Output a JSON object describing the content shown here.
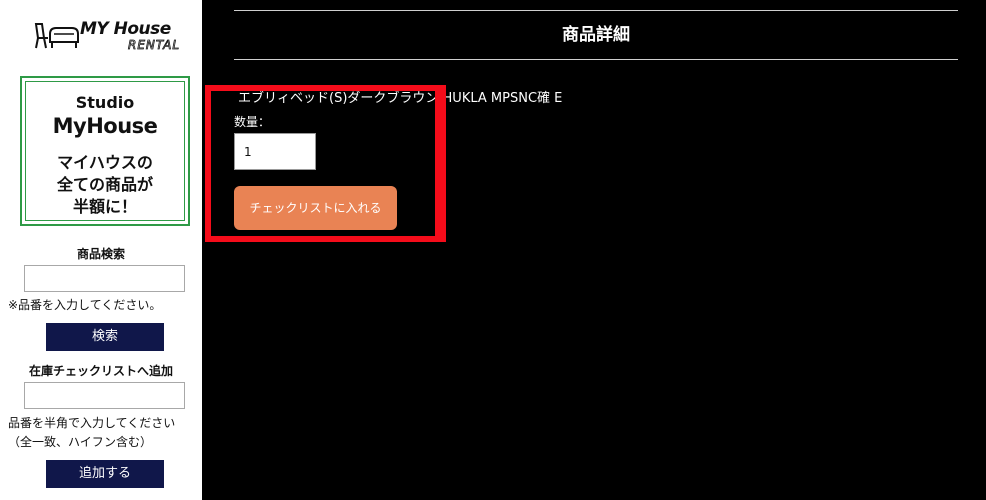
{
  "logo": {
    "main": "MY House",
    "sub": "RENTAL",
    "icon": "furniture-icon"
  },
  "banner": {
    "studio": "Studio",
    "brand": "MyHouse",
    "line1": "マイハウスの",
    "line2": "全ての商品が",
    "line3": "半額に！",
    "border_color": "#2e9a46"
  },
  "search": {
    "heading": "商品検索",
    "input_value": "",
    "note": "※品番を入力してください。",
    "button": "検索"
  },
  "checklist_add": {
    "heading": "在庫チェックリストへ追加",
    "input_value": "",
    "note_line1": "品番を半角で入力してください",
    "note_line2": "（全一致、ハイフン含む）",
    "button": "追加する"
  },
  "detail": {
    "title": "商品詳細",
    "product_name": "エブリィベッド(S)ダークブラウン HUKLA MPSNC確 E",
    "qty_label": "数量：",
    "qty_value": "1",
    "add_button": "チェックリストに入れる"
  },
  "colors": {
    "background": "#000000",
    "sidebar": "#ffffff",
    "button_navy": "#10174a",
    "button_orange": "#e98354",
    "highlight": "#f50c1a"
  }
}
